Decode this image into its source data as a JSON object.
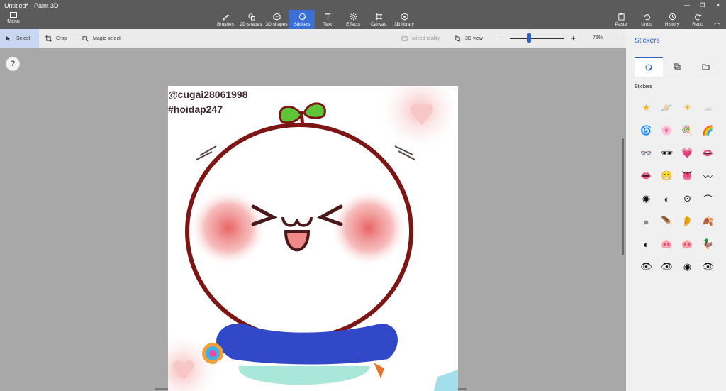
{
  "window": {
    "title": "Untitled* - Paint 3D",
    "menu_label": "Menu"
  },
  "ribbon": {
    "tools": [
      {
        "label": "Brushes",
        "icon": "brush-icon"
      },
      {
        "label": "2D shapes",
        "icon": "2d-shapes-icon"
      },
      {
        "label": "3D shapes",
        "icon": "3d-shapes-icon"
      },
      {
        "label": "Stickers",
        "icon": "stickers-icon",
        "active": true
      },
      {
        "label": "Text",
        "icon": "text-icon"
      },
      {
        "label": "Effects",
        "icon": "effects-icon"
      },
      {
        "label": "Canvas",
        "icon": "canvas-icon"
      },
      {
        "label": "3D library",
        "icon": "3d-library-icon"
      }
    ],
    "actions": [
      {
        "label": "Paste",
        "icon": "paste-icon"
      },
      {
        "label": "Undo",
        "icon": "undo-icon"
      },
      {
        "label": "History",
        "icon": "history-icon"
      },
      {
        "label": "Redo",
        "icon": "redo-icon"
      }
    ]
  },
  "subbar": {
    "select": "Select",
    "crop": "Crop",
    "magic_select": "Magic select",
    "mixed_reality": "Mixed reality",
    "view_3d": "3D view",
    "zoom_value": "75%",
    "zoom_level": 0.35
  },
  "canvas": {
    "text_line_1": "@cugai28061998",
    "text_line_2": "#hoidap247"
  },
  "help_label": "?",
  "panel": {
    "title": "Stickers",
    "section_label": "Stickers",
    "tabs": [
      {
        "icon": "stickers-tab-icon",
        "active": true
      },
      {
        "icon": "textures-tab-icon"
      },
      {
        "icon": "custom-folder-icon"
      }
    ],
    "stickers": [
      "★",
      "🪐",
      "☀",
      "☁",
      "🌀",
      "🌸",
      "🍭",
      "🌈",
      "👓",
      "🕶",
      "💗",
      "👄",
      "👄",
      "😁",
      "👅",
      "〰",
      "◉",
      "◐",
      "⊙",
      "⌒",
      "●",
      "🪶",
      "👂",
      "🍂",
      "◐",
      "🐽",
      "🐽",
      "🦆",
      "👁",
      "👁",
      "◉",
      "👁"
    ],
    "colors": {
      "accent": "#2f5fc0",
      "ribbon_bg": "#5b5b5b",
      "panel_bg": "#f0f0f0"
    }
  }
}
